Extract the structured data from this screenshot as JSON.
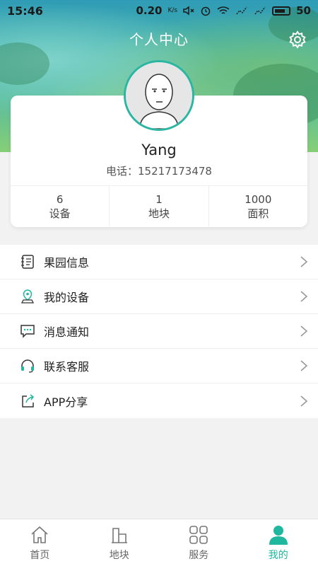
{
  "status_bar": {
    "time": "15:46",
    "network_speed": "0.20",
    "speed_unit": "K/s",
    "battery": "50"
  },
  "header": {
    "title": "个人中心",
    "settings_icon": "gear-icon"
  },
  "profile": {
    "name": "Yang",
    "phone": "电话：15217173478",
    "stats": [
      {
        "value": "6",
        "label": "设备"
      },
      {
        "value": "1",
        "label": "地块"
      },
      {
        "value": "1000",
        "label": "面积"
      }
    ]
  },
  "menu": [
    {
      "label": "果园信息",
      "icon": "notebook-icon"
    },
    {
      "label": "我的设备",
      "icon": "location-pin-icon"
    },
    {
      "label": "消息通知",
      "icon": "message-icon"
    },
    {
      "label": "联系客服",
      "icon": "headset-icon"
    },
    {
      "label": "APP分享",
      "icon": "share-icon"
    }
  ],
  "tabbar": [
    {
      "label": "首页",
      "icon": "home-icon"
    },
    {
      "label": "地块",
      "icon": "plot-icon"
    },
    {
      "label": "服务",
      "icon": "grid-icon"
    },
    {
      "label": "我的",
      "icon": "person-icon",
      "active": true
    }
  ],
  "colors": {
    "accent": "#1fb89f",
    "avatar_ring": "#2bb6a3"
  }
}
